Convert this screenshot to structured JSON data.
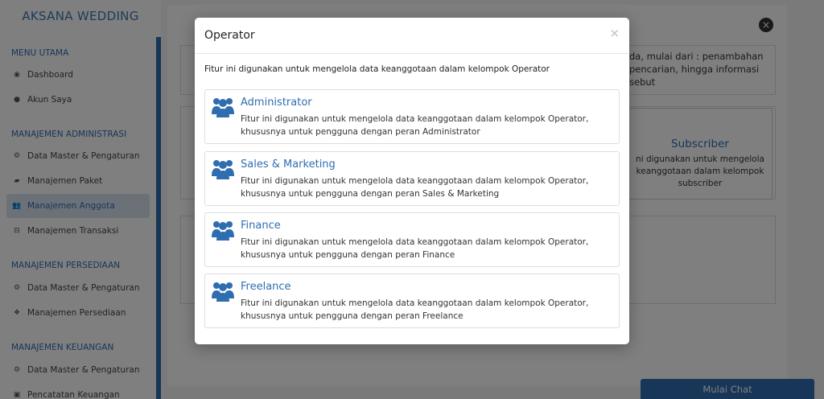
{
  "sidebar": {
    "brand": "AKSANA WEDDING",
    "sections": [
      {
        "title": "MENU UTAMA"
      },
      {
        "title": "MANAJEMEN ADMINISTRASI"
      },
      {
        "title": "MANAJEMEN PERSEDIAAN"
      },
      {
        "title": "MANAJEMEN KEUANGAN"
      }
    ],
    "items": [
      {
        "label": "Dashboard",
        "icon": "palette-icon"
      },
      {
        "label": "Akun Saya",
        "icon": "user-icon"
      },
      {
        "label": "Data Master & Pengaturan",
        "icon": "cogs-icon"
      },
      {
        "label": "Manajemen Paket",
        "icon": "book-icon"
      },
      {
        "label": "Manajemen Anggota",
        "icon": "users-icon",
        "active": true
      },
      {
        "label": "Manajemen Transaksi",
        "icon": "cart-icon"
      },
      {
        "label": "Data Master & Pengaturan",
        "icon": "cogs-icon"
      },
      {
        "label": "Manajemen Persediaan",
        "icon": "cubes-icon"
      },
      {
        "label": "Data Master & Pengaturan",
        "icon": "cogs-icon"
      },
      {
        "label": "Pencatatan Keuangan",
        "icon": "money-icon"
      }
    ]
  },
  "background": {
    "intro_fragments": [
      "da, mulai dari : penambahan",
      "pencarian, hingga informasi",
      "sebut"
    ],
    "card": {
      "title": "Subscriber",
      "desc_lines": [
        "ni digunakan untuk mengelola",
        "keanggotaan dalam kelompok",
        "subscriber"
      ]
    },
    "chat_label": "Mulai Chat"
  },
  "modal": {
    "title": "Operator",
    "close": "×",
    "intro": "Fitur ini digunakan untuk mengelola data keanggotaan dalam kelompok Operator",
    "options": [
      {
        "title": "Administrator",
        "line1": "Fitur ini digunakan untuk mengelola data keanggotaan dalam kelompok Operator,",
        "line2": "khususnya untuk pengguna dengan peran Administrator"
      },
      {
        "title": "Sales & Marketing",
        "line1": "Fitur ini digunakan untuk mengelola data keanggotaan dalam kelompok Operator,",
        "line2": "khususnya untuk pengguna dengan peran Sales & Marketing"
      },
      {
        "title": "Finance",
        "line1": "Fitur ini digunakan untuk mengelola data keanggotaan dalam kelompok Operator,",
        "line2": "khususnya untuk pengguna dengan peran Finance"
      },
      {
        "title": "Freelance",
        "line1": "Fitur ini digunakan untuk mengelola data keanggotaan dalam kelompok Operator,",
        "line2": "khususnya untuk pengguna dengan peran Freelance"
      }
    ]
  },
  "colors": {
    "accent": "#2f6db1",
    "active_bg": "#d9e3ef",
    "overlay": "rgba(0,0,0,0.5)"
  }
}
